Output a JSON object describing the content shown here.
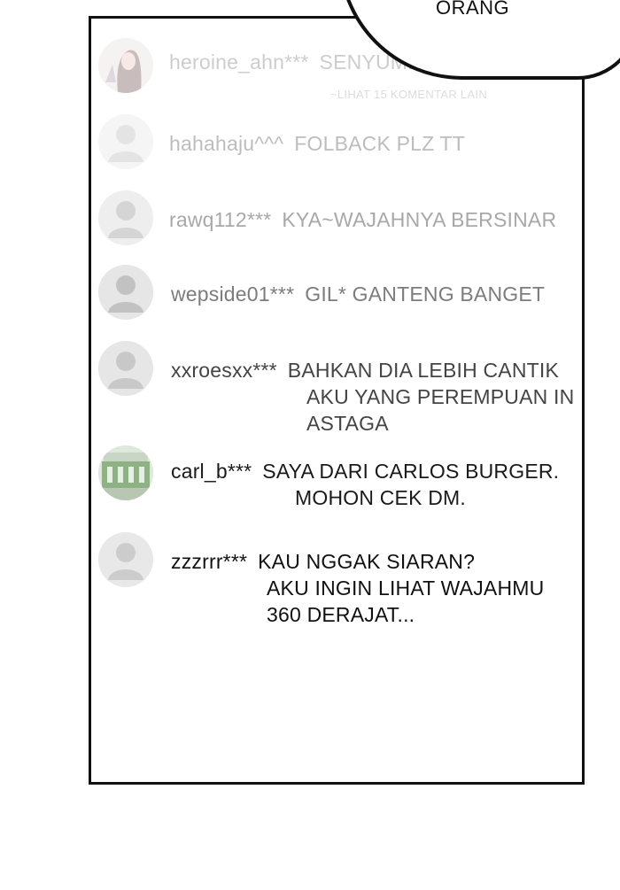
{
  "bubble": {
    "text": "ORANG"
  },
  "more_comments": "~LIHAT 15 KOMENTAR LAIN",
  "comments": [
    {
      "username": "heroine_ahn***",
      "lines": [
        "SENYUMNYA CANTIK BANGET KA"
      ]
    },
    {
      "username": "hahahaju^^^",
      "lines": [
        "FOLBACK PLZ TT"
      ]
    },
    {
      "username": "rawq112***",
      "lines": [
        "KYA~WAJAHNYA BERSINAR"
      ]
    },
    {
      "username": "wepside01***",
      "lines": [
        "GIL* GANTENG BANGET"
      ]
    },
    {
      "username": "xxroesxx***",
      "lines": [
        "BAHKAN DIA LEBIH CANTIK",
        "AKU YANG PEREMPUAN IN",
        "ASTAGA"
      ]
    },
    {
      "username": "carl_b***",
      "lines": [
        "SAYA DARI CARLOS BURGER.",
        "MOHON CEK DM."
      ]
    },
    {
      "username": "zzzrrr***",
      "lines": [
        "KAU NGGAK SIARAN?",
        "AKU INGIN LIHAT WAJAHMU",
        "360 DERAJAT..."
      ]
    }
  ],
  "avatars": [
    "photo-woman",
    "default",
    "default",
    "default",
    "default",
    "photo-building",
    "default"
  ],
  "colors": {
    "border": "#111111",
    "avatar_default": "#d9d9d9"
  }
}
